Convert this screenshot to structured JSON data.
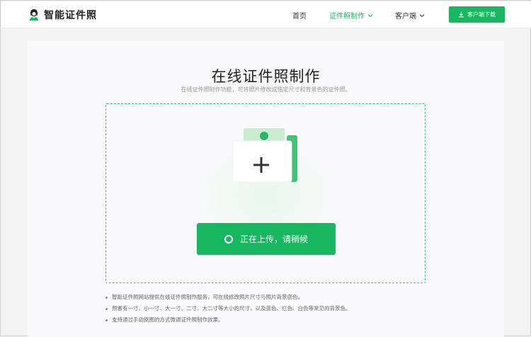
{
  "header": {
    "logo_text": "智能证件照",
    "nav": [
      {
        "label": "首页"
      },
      {
        "label": "证件照制作"
      },
      {
        "label": "客户端"
      }
    ],
    "download_button": "客户端下载"
  },
  "main": {
    "title": "在线证件照制作",
    "subtitle": "在线证件照制作功能，可将照片修改成指定尺寸和背景色的证件照。",
    "upload_button": "正在上传，请稍候",
    "notes": [
      "智能证件照网站提供在线证件照制作服务，可在线修改照片尺寸与照片背景底色。",
      "预置有一寸、小一寸、大一寸、二寸、大二寸等大小的尺寸，以及蓝色、红色、白色等常见的背景色。",
      "支持通过手动抠图的方式微调证件照制作效果。"
    ]
  },
  "colors": {
    "accent": "#17b760",
    "dashed_border": "#3cc474",
    "text_dark": "#222222",
    "text_muted": "#999999"
  },
  "icons": [
    "person-avatar-icon",
    "chevron-down-icon",
    "download-icon",
    "photo-upload-icon",
    "plus-icon",
    "spinner-icon"
  ]
}
